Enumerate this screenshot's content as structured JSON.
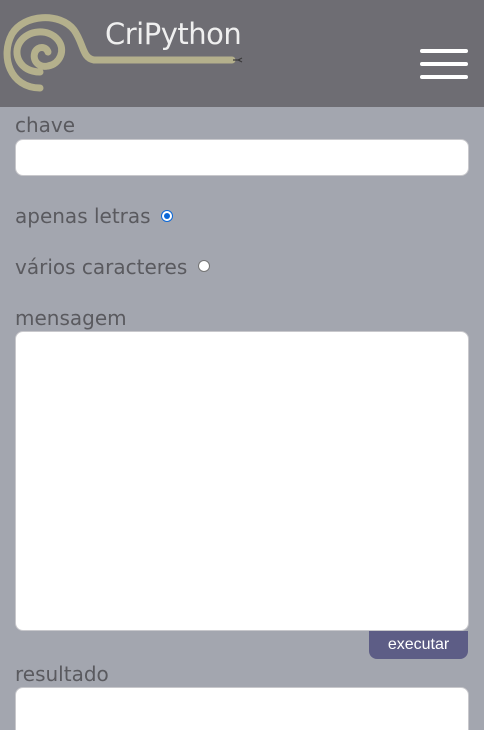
{
  "header": {
    "brand": "CriPython",
    "logo_icon": "spiral-snake-icon",
    "menu_icon": "hamburger-menu-icon"
  },
  "form": {
    "key_label": "chave",
    "key_value": "",
    "mode_letters_label": "apenas letras",
    "mode_letters_checked": true,
    "mode_chars_label": "vários caracteres",
    "mode_chars_checked": false,
    "message_label": "mensagem",
    "message_value": "",
    "execute_label": "executar",
    "result_label": "resultado",
    "result_value": ""
  },
  "colors": {
    "header_bg": "#6e6d73",
    "body_bg": "#a3a6af",
    "logo": "#b4b08c",
    "button": "#5d5d86",
    "radio_accent": "#0a67d8"
  }
}
